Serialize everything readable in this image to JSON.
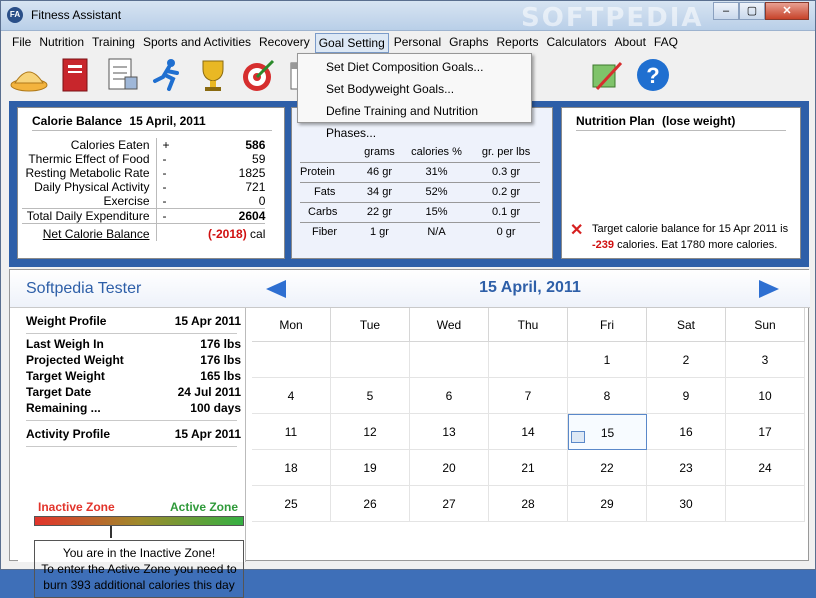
{
  "window": {
    "title": "Fitness Assistant",
    "app_icon": "FA",
    "watermark": "SOFTPEDIA",
    "minimize": "–",
    "maximize": "▢",
    "close": "✕"
  },
  "menu": [
    "File",
    "Nutrition",
    "Training",
    "Sports and Activities",
    "Recovery",
    "Goal Setting",
    "Personal",
    "Graphs",
    "Reports",
    "Calculators",
    "About",
    "FAQ"
  ],
  "toolbar_icons": [
    "food-plate-icon",
    "book-icon",
    "checklist-icon",
    "runner-icon",
    "trophy-icon",
    "target-icon",
    "calendar-icon",
    "calculator-icon",
    "export-icon",
    "help-icon"
  ],
  "goal_menu": [
    "Set Diet Composition Goals...",
    "Set Bodyweight Goals...",
    "Define Training and Nutrition Phases..."
  ],
  "calorie_balance": {
    "title": "Calorie Balance",
    "date": "15 April, 2011",
    "rows": [
      {
        "label": "Calories Eaten",
        "sign": "+",
        "value": "586"
      },
      {
        "label": "Thermic Effect of Food",
        "sign": "-",
        "value": "59"
      },
      {
        "label": "Resting Metabolic Rate",
        "sign": "-",
        "value": "1825"
      },
      {
        "label": "Daily Physical Activity",
        "sign": "-",
        "value": "721"
      },
      {
        "label": "Exercise",
        "sign": "-",
        "value": "0"
      },
      {
        "label": "Total Daily Expenditure",
        "sign": "-",
        "value": "2604"
      }
    ],
    "net_label": "Net Calorie Balance",
    "net_value": "(-2018)",
    "net_unit": "cal"
  },
  "nutrition": {
    "headers": [
      "",
      "grams",
      "calories %",
      "gr. per lbs"
    ],
    "rows": [
      [
        "Protein",
        "46 gr",
        "31%",
        "0.3 gr"
      ],
      [
        "Fats",
        "34 gr",
        "52%",
        "0.2 gr"
      ],
      [
        "Carbs",
        "22 gr",
        "15%",
        "0.1 gr"
      ],
      [
        "Fiber",
        "1 gr",
        "N/A",
        "0 gr"
      ]
    ]
  },
  "nutrition_plan": {
    "title": "Nutrition Plan",
    "mode": "(lose weight)",
    "message_prefix": "Target calorie balance for 15 Apr 2011 is",
    "message_value": "-239",
    "message_suffix": "calories. Eat 1780 more calories."
  },
  "user": {
    "name": "Softpedia Tester"
  },
  "calendar": {
    "header_date": "15 April, 2011",
    "days": [
      "Mon",
      "Tue",
      "Wed",
      "Thu",
      "Fri",
      "Sat",
      "Sun"
    ],
    "weeks": [
      [
        "",
        "",
        "",
        "",
        "1",
        "2",
        "3"
      ],
      [
        "4",
        "5",
        "6",
        "7",
        "8",
        "9",
        "10"
      ],
      [
        "11",
        "12",
        "13",
        "14",
        "15",
        "16",
        "17"
      ],
      [
        "18",
        "19",
        "20",
        "21",
        "22",
        "23",
        "24"
      ],
      [
        "25",
        "26",
        "27",
        "28",
        "29",
        "30",
        ""
      ]
    ],
    "today": "15"
  },
  "profile": {
    "weight_label": "Weight Profile",
    "weight_date": "15 Apr 2011",
    "rows": [
      {
        "label": "Last Weigh In",
        "value": "176 lbs"
      },
      {
        "label": "Projected Weight",
        "value": "176 lbs"
      },
      {
        "label": "Target Weight",
        "value": "165 lbs"
      },
      {
        "label": "Target Date",
        "value": "24 Jul 2011"
      },
      {
        "label": "Remaining ...",
        "value": "100 days"
      }
    ],
    "activity_label": "Activity Profile",
    "activity_date": "15 Apr 2011",
    "inactive_label": "Inactive Zone",
    "active_label": "Active Zone",
    "inactive_color": "#e2342b",
    "active_color": "#35b043",
    "zone_level": 0.36,
    "note": [
      "You are in the Inactive Zone!",
      "To enter the Active Zone you need to",
      "burn 393 additional calories this day"
    ]
  }
}
